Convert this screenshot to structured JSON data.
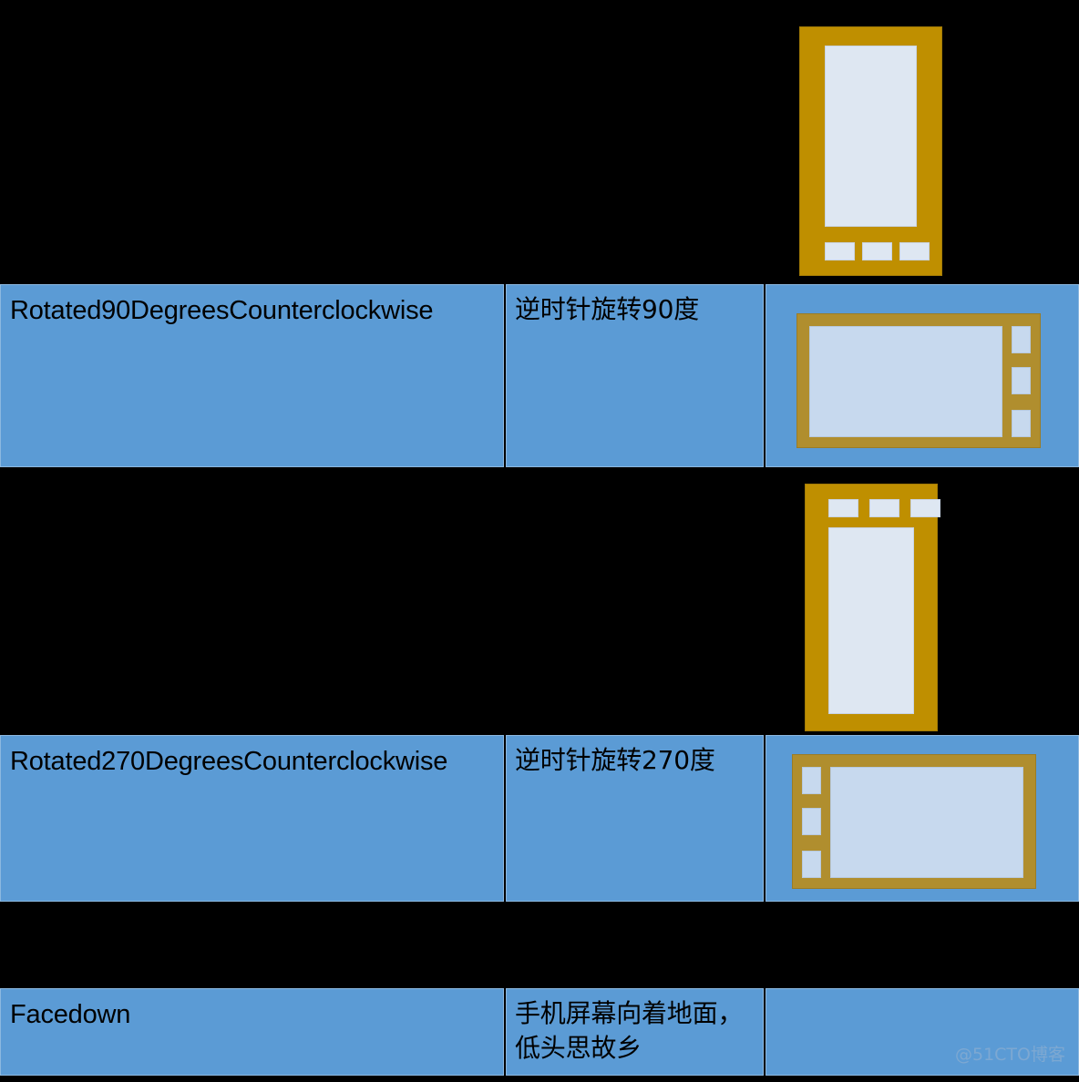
{
  "page": {
    "background_color": "#000000",
    "row_fill_color": "#5B9BD5",
    "phone_frame_color": "#BF8F00",
    "phone_screen_color": "#DEE7F2",
    "watermark": "@51CTO博客"
  },
  "table": {
    "rows": [
      {
        "id": "row-portrait-top",
        "name_label": "",
        "description_label": "",
        "icon": "phone-portrait-buttons-bottom-icon",
        "visible_band": false
      },
      {
        "id": "row-rotated-90",
        "name_label": "Rotated90DegreesCounterclockwise",
        "description_label": "逆时针旋转90度",
        "icon": "phone-landscape-buttons-right-icon",
        "visible_band": true
      },
      {
        "id": "row-portrait-upside-down",
        "name_label": "",
        "description_label": "",
        "icon": "phone-portrait-buttons-top-icon",
        "visible_band": false
      },
      {
        "id": "row-rotated-270",
        "name_label": "Rotated270DegreesCounterclockwise",
        "description_label": "逆时针旋转270度",
        "icon": "phone-landscape-buttons-left-icon",
        "visible_band": true
      },
      {
        "id": "row-facedown",
        "name_label": "Facedown",
        "description_label": "手机屏幕向着地面，低头思故乡",
        "icon": "none",
        "visible_band": true
      }
    ]
  }
}
